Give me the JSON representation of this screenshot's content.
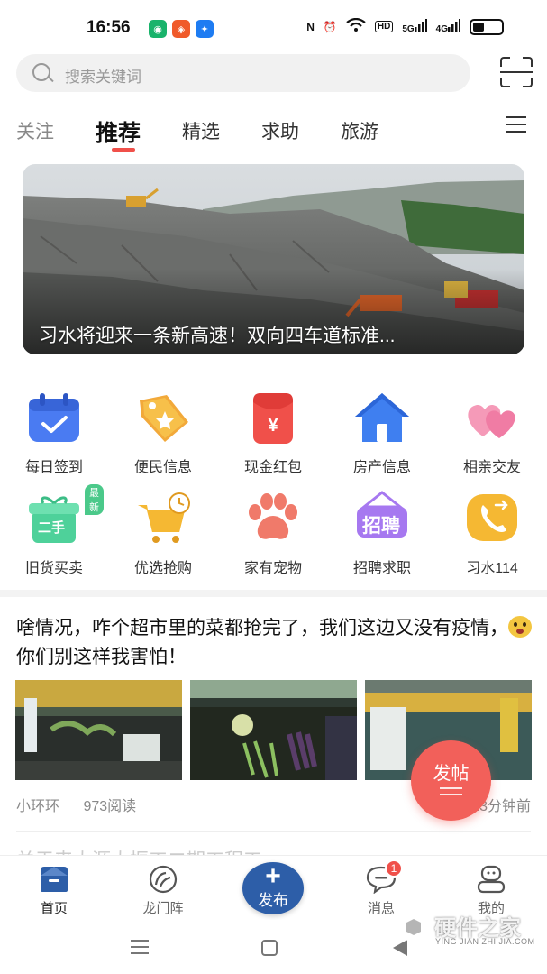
{
  "status_bar": {
    "time": "16:56",
    "apps": [
      {
        "glyph": "◉",
        "color": "#19b36b"
      },
      {
        "glyph": "◈",
        "color": "#f05a2a"
      },
      {
        "glyph": "✦",
        "color": "#1e7cf2"
      }
    ],
    "right_labels": [
      "N",
      "⏰",
      "HD",
      "5G",
      "4G"
    ]
  },
  "search": {
    "placeholder": "搜索关键词"
  },
  "tabs": [
    {
      "label": "关注",
      "state": "muted"
    },
    {
      "label": "推荐",
      "state": "active"
    },
    {
      "label": "精选",
      "state": "normal"
    },
    {
      "label": "求助",
      "state": "normal"
    },
    {
      "label": "旅游",
      "state": "normal"
    }
  ],
  "banner": {
    "caption": "习水将迎来一条新高速！双向四车道标准..."
  },
  "grid": [
    {
      "label": "每日签到",
      "icon": "calendar-check-icon",
      "color": "#4a7bf2"
    },
    {
      "label": "便民信息",
      "icon": "tag-star-icon",
      "color": "#f2a93a"
    },
    {
      "label": "现金红包",
      "icon": "red-packet-icon",
      "color": "#f0504a"
    },
    {
      "label": "房产信息",
      "icon": "house-icon",
      "color": "#3f7ff0"
    },
    {
      "label": "相亲交友",
      "icon": "hearts-icon",
      "color": "#f07ca4"
    },
    {
      "label": "旧货买卖",
      "icon": "secondhand-box-icon",
      "color": "#4ed19a",
      "badge": "最新",
      "icon_text": "二手"
    },
    {
      "label": "优选抢购",
      "icon": "shopping-cart-icon",
      "color": "#f5b833"
    },
    {
      "label": "家有宠物",
      "icon": "paw-icon",
      "color": "#f07a6a"
    },
    {
      "label": "招聘求职",
      "icon": "recruit-sign-icon",
      "color": "#a678f0",
      "icon_text": "招聘"
    },
    {
      "label": "习水114",
      "icon": "phone-call-icon",
      "color": "#f5b833"
    }
  ],
  "post": {
    "title_part1": "啥情况，咋个超市里的菜都抢完了，我们这边又没有疫情，",
    "title_part2": "你们别这样我害怕！",
    "author": "小环环",
    "reads": "973阅读",
    "time": "23分钟前"
  },
  "fab": {
    "label": "发帖"
  },
  "next_post_peek": "关于来太源太振工二期工程工",
  "bottom_nav": [
    {
      "label": "首页",
      "icon": "home-tab-icon",
      "active": true
    },
    {
      "label": "龙门阵",
      "icon": "chat-circle-icon",
      "active": false
    },
    {
      "label": "消息",
      "icon": "message-bubble-icon",
      "active": false,
      "badge": "1"
    },
    {
      "label": "我的",
      "icon": "profile-face-icon",
      "active": false
    }
  ],
  "publish": {
    "label": "发布"
  },
  "watermark": {
    "cn": "硬件之家",
    "en": "YING JIAN ZHI JIA.COM"
  }
}
